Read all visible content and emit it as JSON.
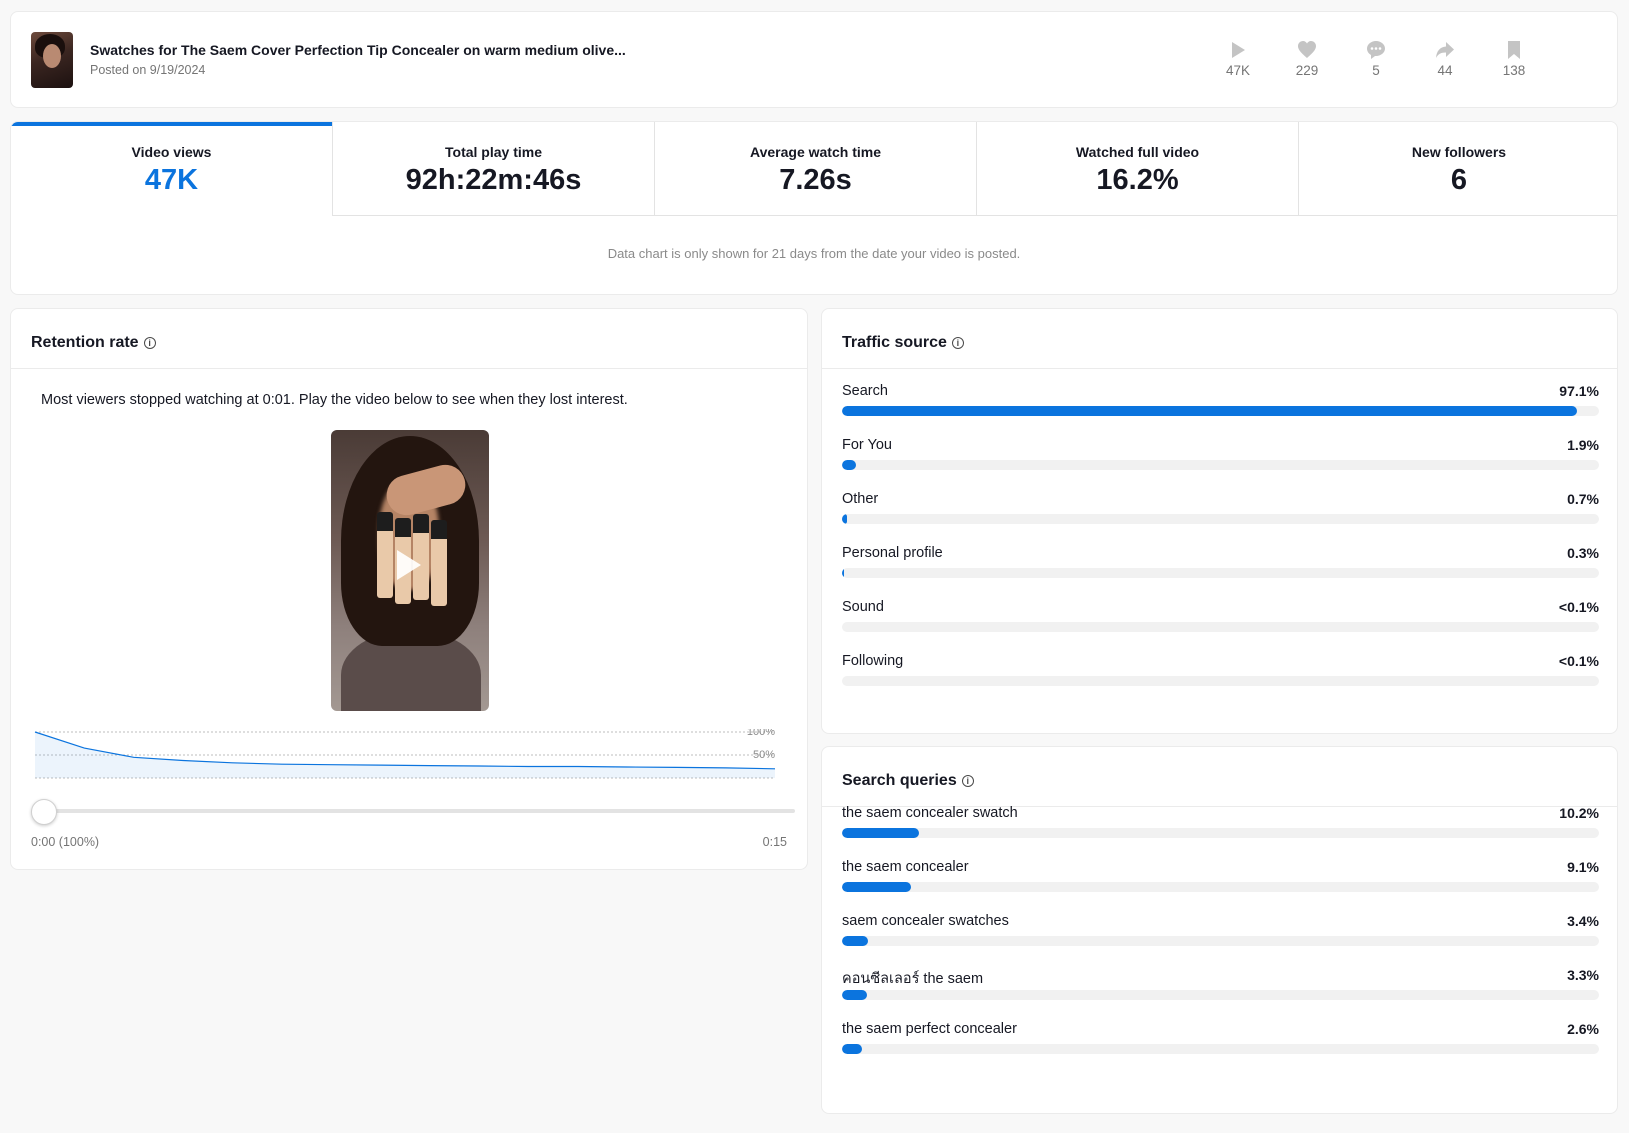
{
  "header": {
    "title": "Swatches for The Saem Cover Perfection Tip Concealer on warm medium olive...",
    "posted": "Posted on 9/19/2024",
    "stats": [
      {
        "icon": "play-icon",
        "value": "47K"
      },
      {
        "icon": "heart-icon",
        "value": "229"
      },
      {
        "icon": "comment-icon",
        "value": "5"
      },
      {
        "icon": "share-icon",
        "value": "44"
      },
      {
        "icon": "bookmark-icon",
        "value": "138"
      }
    ]
  },
  "metrics": [
    {
      "label": "Video views",
      "value": "47K"
    },
    {
      "label": "Total play time",
      "value": "92h:22m:46s"
    },
    {
      "label": "Average watch time",
      "value": "7.26s"
    },
    {
      "label": "Watched full video",
      "value": "16.2%"
    },
    {
      "label": "New followers",
      "value": "6"
    }
  ],
  "chart_note": "Data chart is only shown for 21 days from the date your video is posted.",
  "retention": {
    "title": "Retention rate",
    "message": "Most viewers stopped watching at 0:01. Play the video below to see when they lost interest.",
    "start_label": "0:00 (100%)",
    "end_label": "0:15",
    "tick_100": "100%",
    "tick_50": "50%"
  },
  "chart_data": {
    "type": "area",
    "x": [
      0,
      1,
      2,
      3,
      4,
      5,
      6,
      7,
      8,
      9,
      10,
      11,
      12,
      13,
      14,
      15
    ],
    "y": [
      100,
      65,
      45,
      38,
      33,
      30,
      29,
      28,
      27,
      26,
      25,
      25,
      24,
      23,
      22,
      20
    ],
    "xlabel": "",
    "ylabel": "",
    "xlim": [
      0,
      15
    ],
    "ylim": [
      0,
      100
    ],
    "yticks": [
      "100%",
      "50%"
    ],
    "color": "#0b74de"
  },
  "traffic": {
    "title": "Traffic source",
    "items": [
      {
        "label": "Search",
        "value": "97.1%",
        "pct": 97.1
      },
      {
        "label": "For You",
        "value": "1.9%",
        "pct": 1.9
      },
      {
        "label": "Other",
        "value": "0.7%",
        "pct": 0.7
      },
      {
        "label": "Personal profile",
        "value": "0.3%",
        "pct": 0.3
      },
      {
        "label": "Sound",
        "value": "<0.1%",
        "pct": 0
      },
      {
        "label": "Following",
        "value": "<0.1%",
        "pct": 0
      }
    ]
  },
  "search": {
    "title": "Search queries",
    "items": [
      {
        "label": "the saem concealer swatch",
        "value": "10.2%",
        "pct": 10.2
      },
      {
        "label": "the saem concealer",
        "value": "9.1%",
        "pct": 9.1
      },
      {
        "label": "saem concealer swatches",
        "value": "3.4%",
        "pct": 3.4
      },
      {
        "label": "คอนซีลเลอร์ the saem",
        "value": "3.3%",
        "pct": 3.3
      },
      {
        "label": "the saem perfect concealer",
        "value": "2.6%",
        "pct": 2.6
      }
    ]
  },
  "colors": {
    "accent": "#0b74de",
    "track": "#f1f1f1"
  }
}
